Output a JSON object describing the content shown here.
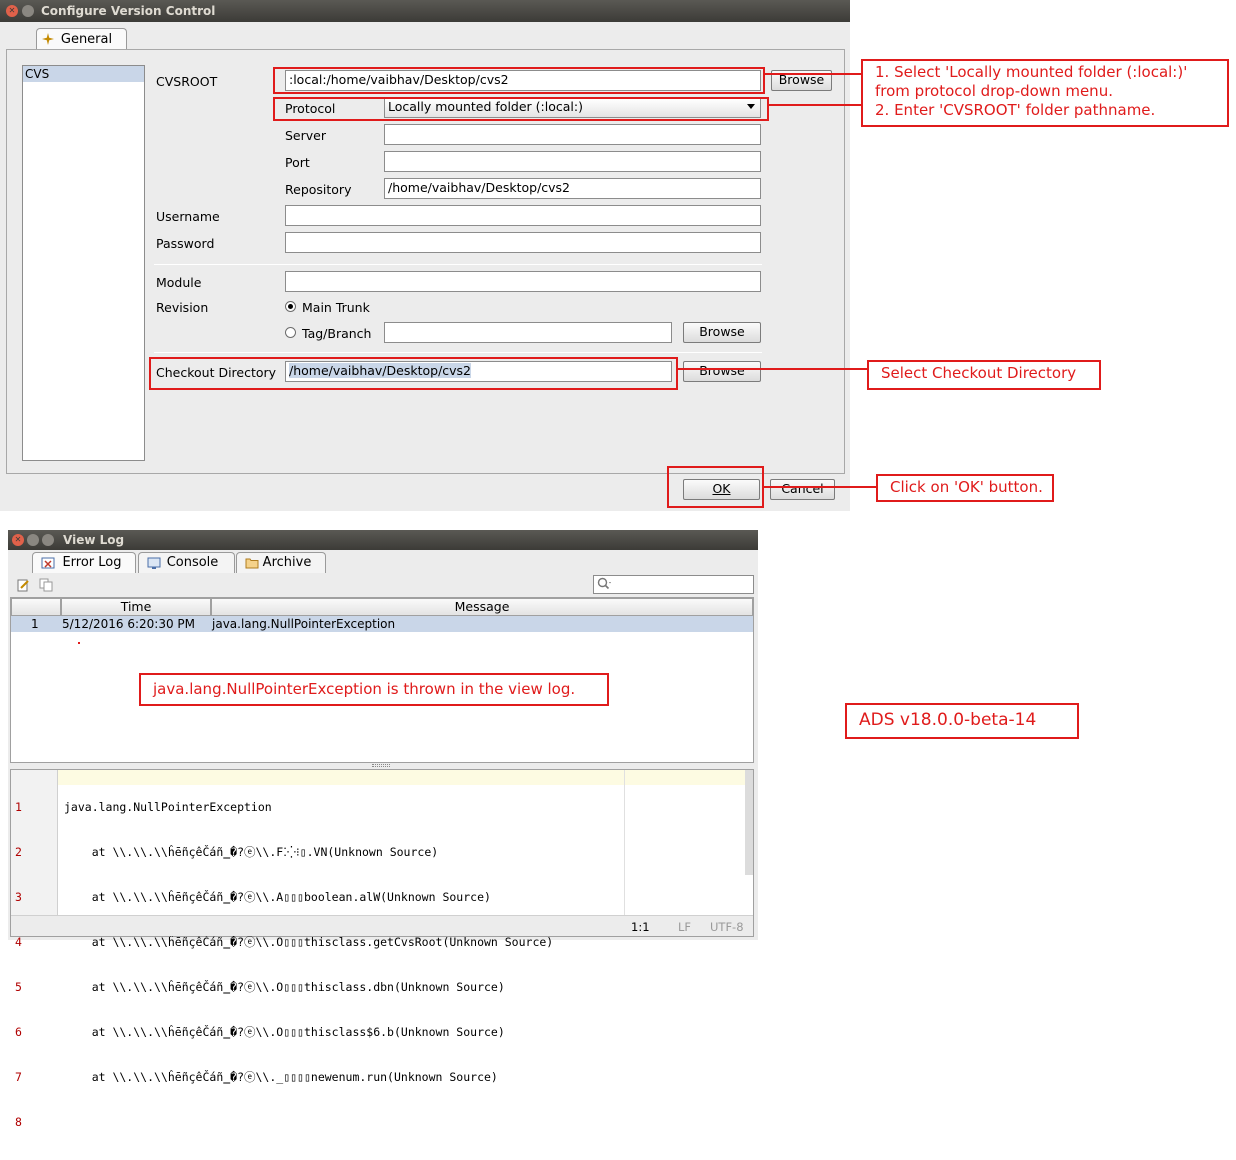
{
  "config_dialog": {
    "title": "Configure Version Control",
    "tab": "General",
    "list_items": [
      "CVS"
    ],
    "labels": {
      "cvsroot": "CVSROOT",
      "protocol": "Protocol",
      "server": "Server",
      "port": "Port",
      "repository": "Repository",
      "username": "Username",
      "password": "Password",
      "module": "Module",
      "revision": "Revision",
      "main_trunk": "Main Trunk",
      "tag_branch": "Tag/Branch",
      "checkout_directory": "Checkout Directory"
    },
    "values": {
      "cvsroot": ":local:/home/vaibhav/Desktop/cvs2",
      "protocol": "Locally mounted folder (:local:)",
      "server": "",
      "port": "",
      "repository": "/home/vaibhav/Desktop/cvs2",
      "username": "",
      "password": "",
      "module": "",
      "tag_branch": "",
      "checkout_directory": "/home/vaibhav/Desktop/cvs2"
    },
    "revision_selected": "Main Trunk",
    "buttons": {
      "browse": "Browse",
      "ok": "OK",
      "cancel": "Cancel"
    }
  },
  "annotations": {
    "cvsroot_note_line1": "1. Select 'Locally mounted folder (:local:)'",
    "cvsroot_note_line2": "from protocol drop-down menu.",
    "cvsroot_note_line3": "2. Enter 'CVSROOT' folder pathname.",
    "checkout_note": "Select Checkout Directory",
    "ok_note": "Click on 'OK' button.",
    "exception_note": "java.lang.NullPointerException is thrown in the view log.",
    "version_note": "ADS v18.0.0-beta-14"
  },
  "view_log": {
    "title": "View Log",
    "tabs": [
      "Error Log",
      "Console",
      "Archive"
    ],
    "columns": [
      "",
      "Time",
      "Message"
    ],
    "rows": [
      {
        "index": "1",
        "time": "5/12/2016 6:20:30 PM",
        "message": "java.lang.NullPointerException"
      }
    ],
    "line_numbers": [
      "1",
      "2",
      "3",
      "4",
      "5",
      "6",
      "7",
      "8"
    ],
    "detail_lines": [
      "java.lang.NullPointerException",
      "    at \\\\.\\\\.\\\\ĥēñçêČáñ‗�?ⓔ\\\\.F⁚⁛⁝▯.VN(Unknown Source)",
      "    at \\\\.\\\\.\\\\ĥēñçêČáñ‗�?ⓔ\\\\.A▯▯▯boolean.alW(Unknown Source)",
      "    at \\\\.\\\\.\\\\ĥēñçêČáñ‗�?ⓔ\\\\.O▯▯▯thisclass.getCvsRoot(Unknown Source)",
      "    at \\\\.\\\\.\\\\ĥēñçêČáñ‗�?ⓔ\\\\.O▯▯▯thisclass.dbn(Unknown Source)",
      "    at \\\\.\\\\.\\\\ĥēñçêČáñ‗�?ⓔ\\\\.O▯▯▯thisclass$6.b(Unknown Source)",
      "    at \\\\.\\\\.\\\\ĥēñçêČáñ‗�?ⓔ\\\\._▯▯▯▯newenum.run(Unknown Source)",
      ""
    ],
    "status": {
      "position": "1:1",
      "line_ending": "LF",
      "encoding": "UTF-8"
    }
  }
}
